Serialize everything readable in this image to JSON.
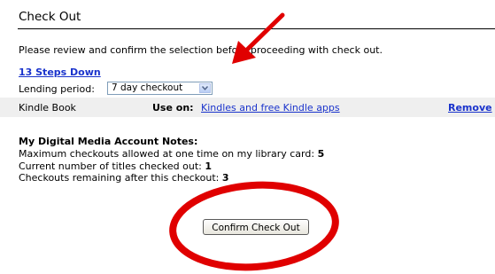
{
  "page": {
    "title": "Check Out",
    "instructions": "Please review and confirm the selection before proceeding with check out."
  },
  "item": {
    "title": "13 Steps Down",
    "lending_label": "Lending period:",
    "lending_value": "7 day checkout",
    "format": "Kindle Book",
    "use_on_label": "Use on:",
    "use_on_link": "Kindles and free Kindle apps",
    "remove_label": "Remove"
  },
  "notes": {
    "heading": "My Digital Media Account Notes:",
    "max_label": "Maximum checkouts allowed at one time on my library card:",
    "max_value": "5",
    "current_label": "Current number of titles checked out:",
    "current_value": "1",
    "remaining_label": "Checkouts remaining after this checkout:",
    "remaining_value": "3"
  },
  "actions": {
    "confirm_label": "Confirm Check Out"
  },
  "colors": {
    "link": "#1a33cc",
    "annotation": "#e00000",
    "row_bg": "#efefef"
  },
  "icons": {
    "dropdown": "chevron-down-icon"
  }
}
